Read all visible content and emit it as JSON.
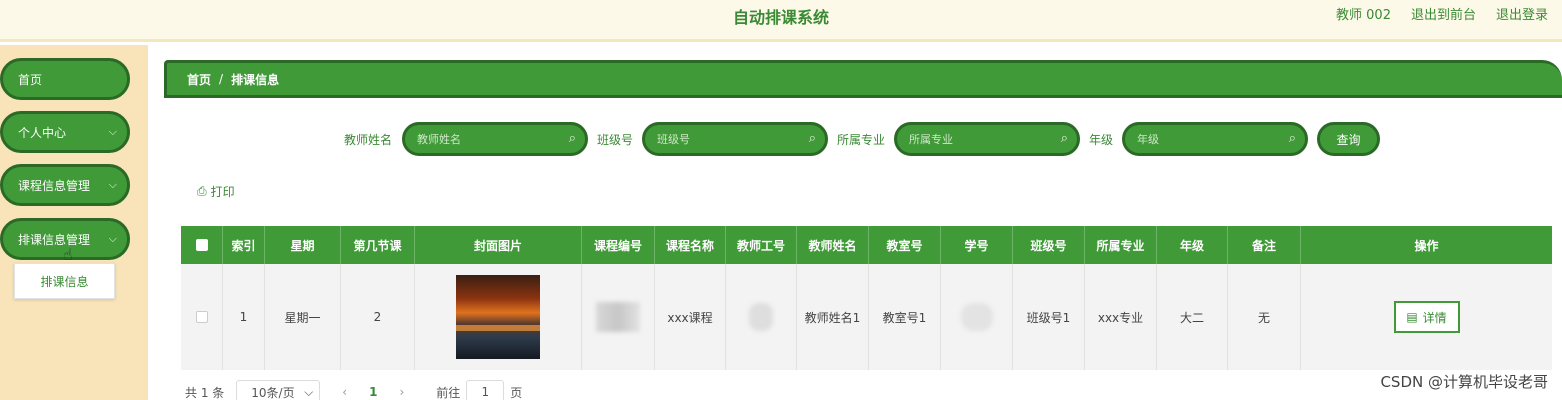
{
  "header": {
    "title": "自动排课系统",
    "user": "教师 002",
    "back_to_front": "退出到前台",
    "logout": "退出登录"
  },
  "sidebar": {
    "items": [
      {
        "label": "首页",
        "has_arrow": false
      },
      {
        "label": "个人中心",
        "has_arrow": true
      },
      {
        "label": "课程信息管理",
        "has_arrow": true
      },
      {
        "label": "排课信息管理",
        "has_arrow": true
      }
    ],
    "submenu_item": "排课信息",
    "arrow_icon": "chevron-down-icon"
  },
  "breadcrumb": {
    "home": "首页",
    "separator": "/",
    "current": "排课信息"
  },
  "search": {
    "fields": [
      {
        "label": "教师姓名",
        "placeholder": "教师姓名"
      },
      {
        "label": "班级号",
        "placeholder": "班级号"
      },
      {
        "label": "所属专业",
        "placeholder": "所属专业"
      },
      {
        "label": "年级",
        "placeholder": "年级"
      }
    ],
    "query_button": "查询"
  },
  "toolbar": {
    "print_label": "打印"
  },
  "table": {
    "headers": [
      "索引",
      "星期",
      "第几节课",
      "封面图片",
      "课程编号",
      "课程名称",
      "教师工号",
      "教师姓名",
      "教室号",
      "学号",
      "班级号",
      "所属专业",
      "年级",
      "备注",
      "操作"
    ],
    "rows": [
      {
        "index": "1",
        "weekday": "星期一",
        "period": "2",
        "course_name": "xxx课程",
        "teacher_name": "教师姓名1",
        "classroom": "教室号1",
        "class_no": "班级号1",
        "major": "xxx专业",
        "grade": "大二",
        "remark": "无",
        "action": "详情"
      }
    ]
  },
  "pagination": {
    "total": "共 1 条",
    "page_size": "10条/页",
    "prev": "‹",
    "current_page": "1",
    "next": "›",
    "goto_label": "前往",
    "goto_value": "1",
    "page_suffix": "页"
  },
  "watermark": "CSDN @计算机毕设老哥",
  "colors": {
    "primary": "#3f9a37",
    "primary_dark": "#2a6a26",
    "sidebar_bg": "#f8e4b8",
    "header_bg": "#fdf9e8"
  }
}
